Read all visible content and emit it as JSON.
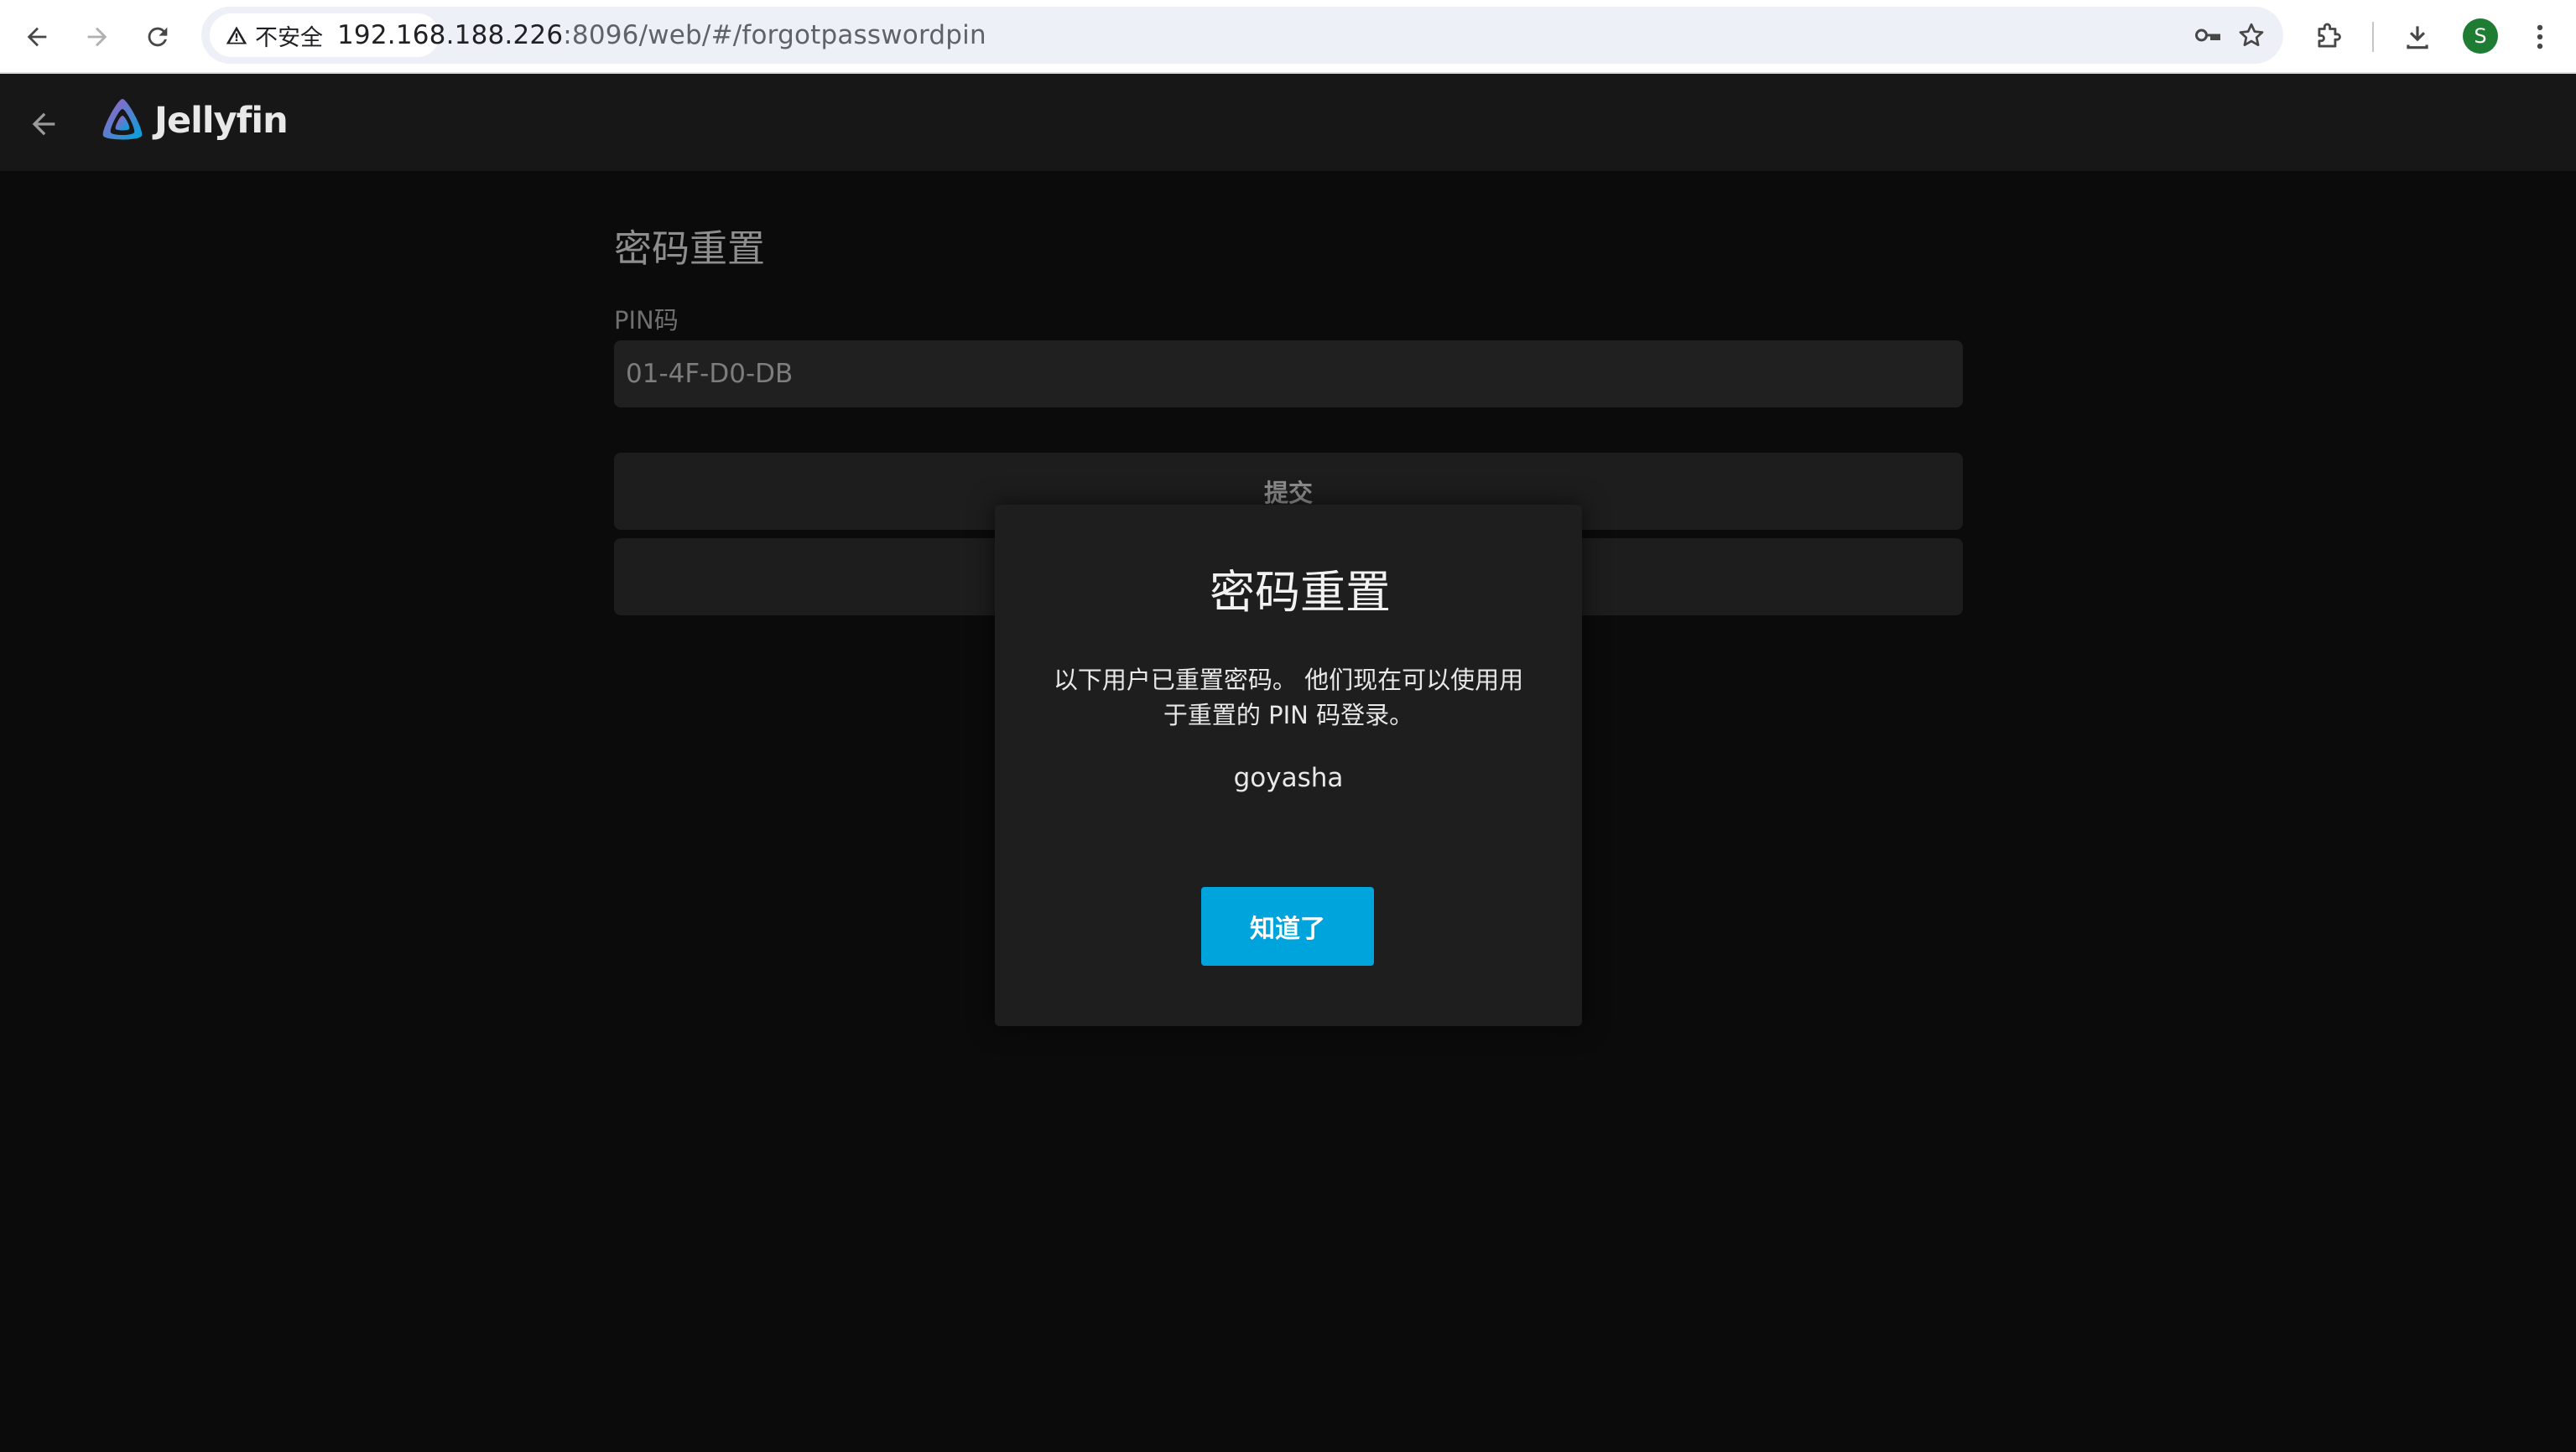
{
  "browser": {
    "security_label": "不安全",
    "url_host": "192.168.188.226",
    "url_path": ":8096/web/#/forgotpasswordpin",
    "profile_initial": "S",
    "icons": [
      "back-arrow-icon",
      "forward-arrow-icon",
      "reload-icon",
      "warning-icon",
      "key-icon",
      "star-icon",
      "extensions-icon",
      "download-icon",
      "kebab-menu-icon"
    ]
  },
  "app": {
    "brand": "Jellyfin",
    "brand_color": "#aa5cc3",
    "accent_color": "#00a4dc"
  },
  "page": {
    "title": "密码重置",
    "pin_label": "PIN码",
    "pin_value": "01-4F-D0-DB",
    "submit_label": "提交",
    "second_button_label": ""
  },
  "dialog": {
    "title": "密码重置",
    "message": "以下用户已重置密码。 他们现在可以使用用于重置的 PIN 码登录。",
    "username": "goyasha",
    "ok_label": "知道了"
  }
}
